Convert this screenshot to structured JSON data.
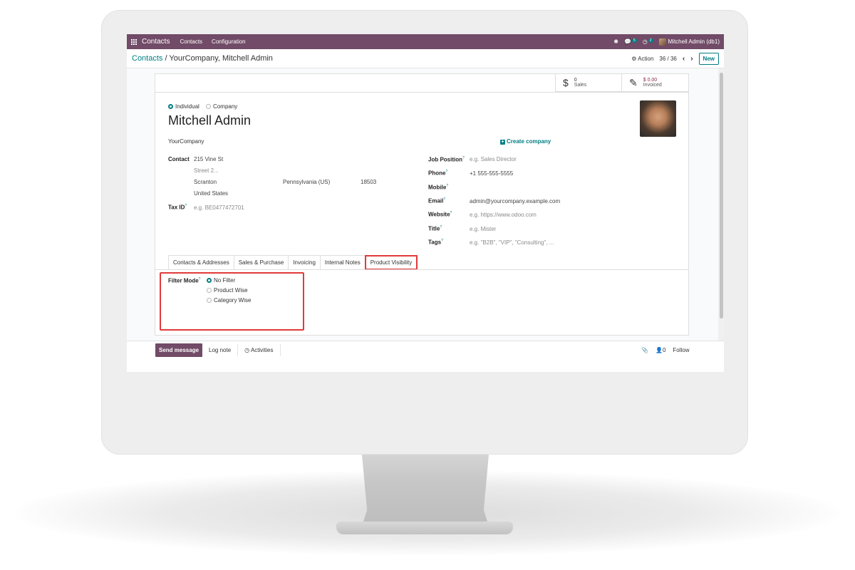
{
  "navbar": {
    "app_name": "Contacts",
    "menu": [
      "Contacts",
      "Configuration"
    ],
    "messages_badge": "5",
    "activities_badge": "2",
    "user": "Mitchell Admin (db1)"
  },
  "control_panel": {
    "breadcrumb_root": "Contacts",
    "breadcrumb_sep": "/",
    "breadcrumb_current": "YourCompany, Mitchell Admin",
    "action_label": "Action",
    "pager": "36 / 36",
    "new_label": "New"
  },
  "stat_buttons": {
    "sales_value": "0",
    "sales_label": "Sales",
    "invoiced_value": "$ 0.00",
    "invoiced_label": "Invoiced"
  },
  "form": {
    "type_individual": "Individual",
    "type_company": "Company",
    "name": "Mitchell Admin",
    "company_name": "YourCompany",
    "create_company": "Create company",
    "contact_label": "Contact",
    "street": "215 Vine St",
    "street2_placeholder": "Street 2...",
    "city": "Scranton",
    "state": "Pennsylvania (US)",
    "zip": "18503",
    "country": "United States",
    "tax_label": "Tax ID",
    "tax_placeholder": "e.g. BE0477472701",
    "job_label": "Job Position",
    "job_placeholder": "e.g. Sales Director",
    "phone_label": "Phone",
    "phone": "+1 555-555-5555",
    "mobile_label": "Mobile",
    "email_label": "Email",
    "email": "admin@yourcompany.example.com",
    "website_label": "Website",
    "website_placeholder": "e.g. https://www.odoo.com",
    "title_label": "Title",
    "title_placeholder": "e.g. Mister",
    "tags_label": "Tags",
    "tags_placeholder": "e.g. \"B2B\", \"VIP\", \"Consulting\", ..."
  },
  "tabs": [
    "Contacts & Addresses",
    "Sales & Purchase",
    "Invoicing",
    "Internal Notes",
    "Product Visibility"
  ],
  "active_tab": "Product Visibility",
  "filter": {
    "label": "Filter Mode",
    "options": [
      "No Filter",
      "Product Wise",
      "Category Wise"
    ],
    "selected": "No Filter"
  },
  "chatter": {
    "send_message": "Send message",
    "log_note": "Log note",
    "activities": "Activities",
    "followers_count": "0",
    "follow": "Follow"
  },
  "colors": {
    "brand": "#714b67",
    "accent": "#017e84",
    "highlight": "#e03a3a"
  }
}
